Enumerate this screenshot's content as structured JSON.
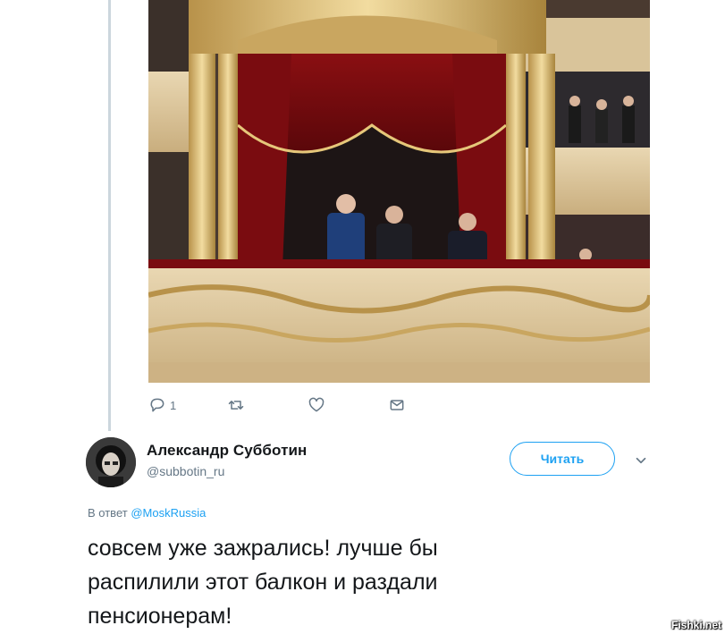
{
  "photo": {
    "alt_icon": "theatre-box-photo"
  },
  "actions": {
    "reply_icon": "reply-icon",
    "reply_count": "1",
    "retweet_icon": "retweet-icon",
    "like_icon": "heart-icon",
    "dm_icon": "envelope-icon"
  },
  "user": {
    "name": "Александр Субботин",
    "handle": "@subbotin_ru",
    "follow_label": "Читать"
  },
  "reply": {
    "prefix": "В ответ",
    "mention": "@MoskRussia"
  },
  "tweet": {
    "line1": "совсем уже зажрались! лучше бы",
    "line2": "распилили этот балкон и раздали",
    "line3": "пенсионерам!"
  },
  "watermark": "Fishki.net",
  "colors": {
    "accent": "#1da1f2",
    "muted": "#657786",
    "text": "#14171a"
  }
}
